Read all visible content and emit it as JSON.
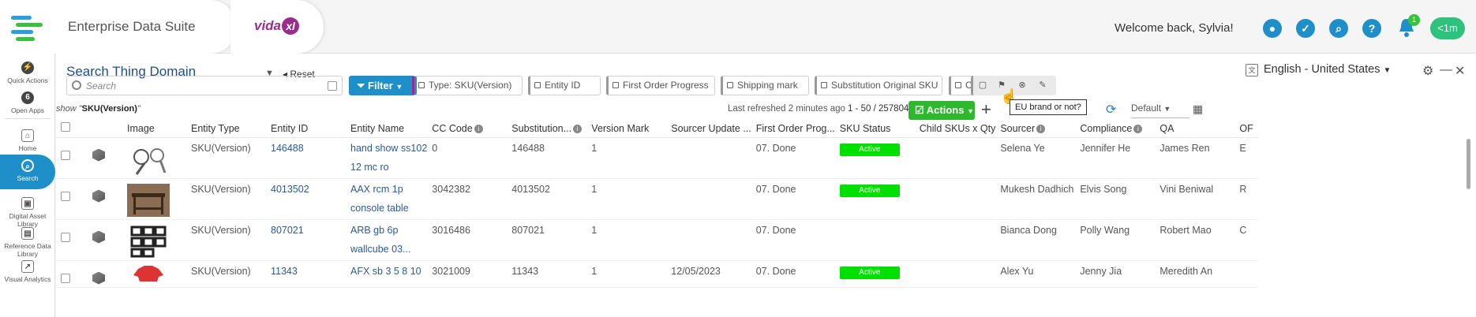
{
  "app": {
    "title": "Enterprise Data Suite",
    "brand": "vida",
    "brand_mark": "xl",
    "welcome": "Welcome back, Sylvia!",
    "notification_count": "1",
    "timer": "<1m"
  },
  "sidebar": {
    "items": [
      {
        "label": "Quick Actions",
        "icon": "lightning-icon",
        "glyph": "⚡"
      },
      {
        "label": "Open Apps",
        "icon": "apps-count-icon",
        "glyph": "6"
      },
      {
        "label": "Home",
        "icon": "home-icon",
        "glyph": "⌂"
      },
      {
        "label": "Search",
        "icon": "search-icon",
        "glyph": "⌕"
      },
      {
        "label": "Digital Asset Library",
        "icon": "image-icon",
        "glyph": "▣"
      },
      {
        "label": "Reference Data Library",
        "icon": "library-icon",
        "glyph": "▤"
      },
      {
        "label": "Visual Analytics",
        "icon": "chart-icon",
        "glyph": "↗"
      }
    ]
  },
  "header": {
    "title": "Search Thing Domain",
    "reset_label": "Reset",
    "language": "English - United States"
  },
  "filters": {
    "search_placeholder": "Search",
    "filter_label": "Filter",
    "chips": [
      "Type: SKU(Version)",
      "Entity ID",
      "First Order Progress",
      "Shipping mark",
      "Substitution Original SKU",
      "CDO"
    ]
  },
  "summary": {
    "show_prefix": "show \"",
    "show_value": "SKU(Version)",
    "show_suffix": "\"",
    "refreshed": "Last refreshed 2 minutes ago",
    "paging": "1 - 50 / 257804",
    "actions_label": "Actions",
    "tooltip": "EU brand or not?",
    "view_default": "Default"
  },
  "table": {
    "columns": [
      "Image",
      "Entity Type",
      "Entity ID",
      "Entity Name",
      "CC Code",
      "Substitution...",
      "Version Mark",
      "Sourcer Update ...",
      "First Order Prog...",
      "SKU Status",
      "Child SKUs x Qty",
      "Sourcer",
      "Compliance",
      "QA",
      "OF"
    ],
    "rows": [
      {
        "entity_type": "SKU(Version)",
        "entity_id": "146488",
        "name1": "hand show ss102",
        "name2": "12 mc ro",
        "cc_code": "0",
        "substitution": "146488",
        "version_mark": "1",
        "sourcer_update": "",
        "first_order": "07. Done",
        "status": "Active",
        "child": "",
        "sourcer": "Selena Ye",
        "compliance": "Jennifer He",
        "qa": "James Ren",
        "of": "E",
        "thumb": "tools"
      },
      {
        "entity_type": "SKU(Version)",
        "entity_id": "4013502",
        "name1": "AAX rcm 1p",
        "name2": "console table",
        "cc_code": "3042382",
        "substitution": "4013502",
        "version_mark": "1",
        "sourcer_update": "",
        "first_order": "07. Done",
        "status": "Active",
        "child": "",
        "sourcer": "Mukesh Dadhich",
        "compliance": "Elvis Song",
        "qa": "Vini Beniwal",
        "of": "R",
        "thumb": "table"
      },
      {
        "entity_type": "SKU(Version)",
        "entity_id": "807021",
        "name1": "ARB gb 6p",
        "name2": "wallcube 03...",
        "cc_code": "3016486",
        "substitution": "807021",
        "version_mark": "1",
        "sourcer_update": "",
        "first_order": "07. Done",
        "status": "",
        "child": "",
        "sourcer": "Bianca Dong",
        "compliance": "Polly Wang",
        "qa": "Robert Mao",
        "of": "C",
        "thumb": "cubes"
      },
      {
        "entity_type": "SKU(Version)",
        "entity_id": "11343",
        "name1": "AFX sb 3 5 8 10",
        "name2": "",
        "cc_code": "3021009",
        "substitution": "11343",
        "version_mark": "1",
        "sourcer_update": "12/05/2023",
        "first_order": "07. Done",
        "status": "Active",
        "child": "",
        "sourcer": "Alex Yu",
        "compliance": "Jenny Jia",
        "qa": "Meredith An",
        "of": "",
        "thumb": "shirt"
      }
    ]
  },
  "colors": {
    "accent": "#1f8fc9",
    "active_status": "#00e000",
    "actions": "#2eb82e",
    "title": "#1d4f8a"
  }
}
